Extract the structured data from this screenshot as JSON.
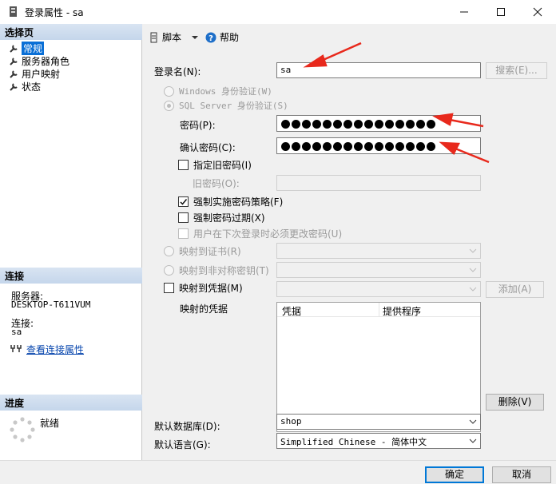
{
  "window": {
    "title": "登录属性 - sa",
    "minimize": "—",
    "maximize": "☐",
    "close": "✕"
  },
  "sidebar": {
    "select_page_header": "选择页",
    "pages": [
      {
        "label": "常规",
        "selected": true
      },
      {
        "label": "服务器角色"
      },
      {
        "label": "用户映射"
      },
      {
        "label": "状态"
      }
    ],
    "connection_header": "连接",
    "server_label": "服务器:",
    "server_value": "DESKTOP-T611VUM",
    "connection_label": "连接:",
    "connection_value": "sa",
    "view_connection_link": "查看连接属性",
    "progress_header": "进度",
    "progress_status": "就绪"
  },
  "toolbar": {
    "script_label": "脚本",
    "help_label": "帮助"
  },
  "form": {
    "login_name_label": "登录名(N):",
    "login_name_value": "sa",
    "search_button": "搜索(E)...",
    "windows_auth": "Windows 身份验证(W)",
    "sql_auth": "SQL Server 身份验证(S)",
    "password_label": "密码(P):",
    "confirm_password_label": "确认密码(C):",
    "specify_old_password": "指定旧密码(I)",
    "old_password_label": "旧密码(O):",
    "enforce_policy": "强制实施密码策略(F)",
    "enforce_expiration": "强制密码过期(X)",
    "must_change": "用户在下次登录时必须更改密码(U)",
    "map_cert": "映射到证书(R)",
    "map_asym_key": "映射到非对称密钥(T)",
    "map_credential": "映射到凭据(M)",
    "add_button": "添加(A)",
    "mapped_credentials_label": "映射的凭据",
    "col_credential": "凭据",
    "col_provider": "提供程序",
    "remove_button": "删除(V)",
    "default_db_label": "默认数据库(D):",
    "default_db_value": "shop",
    "default_lang_label": "默认语言(G):",
    "default_lang_value": "Simplified Chinese - 简体中文"
  },
  "footer": {
    "ok": "确定",
    "cancel": "取消"
  },
  "colors": {
    "annotation_arrow": "#e8291c",
    "selection": "#0a6fd6",
    "header_gradient": "#c5d6eb"
  }
}
